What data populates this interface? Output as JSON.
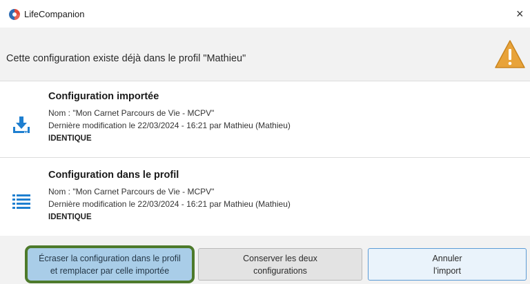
{
  "window": {
    "title": "LifeCompanion",
    "close_glyph": "×"
  },
  "header": {
    "message": "Cette configuration existe déjà dans le profil \"Mathieu\"",
    "icon": "warning-icon",
    "icon_color": "#e8a33a"
  },
  "imported": {
    "icon": "download-icon",
    "icon_color": "#1e7fd0",
    "title": "Configuration importée",
    "name_line": "Nom : \"Mon Carnet Parcours de Vie - MCPV\"",
    "modified_line": "Dernière modification le 22/03/2024 - 16:21 par Mathieu (Mathieu)",
    "status": "IDENTIQUE"
  },
  "existing": {
    "icon": "list-icon",
    "icon_color": "#1e7fd0",
    "title": "Configuration dans le profil",
    "name_line": "Nom : \"Mon Carnet Parcours de Vie - MCPV\"",
    "modified_line": "Dernière modification le 22/03/2024 - 16:21 par Mathieu (Mathieu)",
    "status": "IDENTIQUE"
  },
  "buttons": {
    "overwrite_line1": "Écraser la configuration dans le profil",
    "overwrite_line2": "et remplacer par celle importée",
    "keep_line1": "Conserver les deux",
    "keep_line2": "configurations",
    "cancel_line1": "Annuler",
    "cancel_line2": "l'import"
  }
}
